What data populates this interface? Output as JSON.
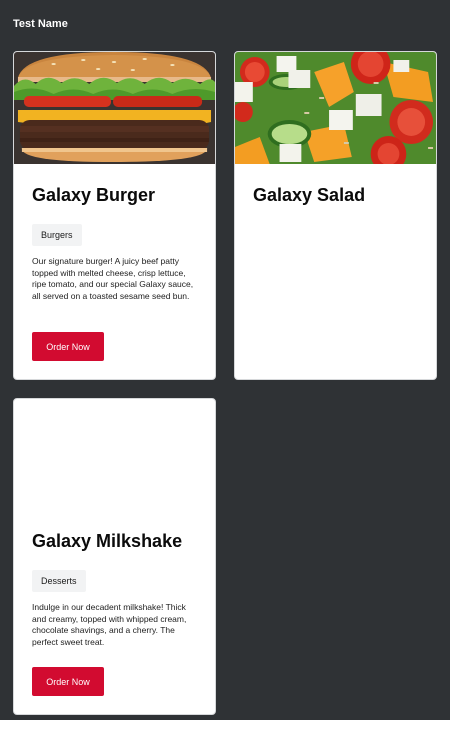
{
  "page": {
    "title": "Test Name"
  },
  "colors": {
    "background": "#2f3235",
    "card": "#ffffff",
    "accent": "#d20b30",
    "badge": "#f2f3f4"
  },
  "cards": [
    {
      "title": "Galaxy Burger",
      "category": "Burgers",
      "description": "Our signature burger! A juicy beef patty topped with melted cheese, crisp lettuce, ripe tomato, and our special Galaxy sauce, all served on a toasted sesame seed bun.",
      "button_label": "Order Now",
      "image": "burger-photo"
    },
    {
      "title": "Galaxy Salad",
      "image": "salad-photo"
    },
    {
      "title": "Galaxy Milkshake",
      "category": "Desserts",
      "description": "Indulge in our decadent milkshake! Thick and creamy, topped with whipped cream, chocolate shavings, and a cherry. The perfect sweet treat.",
      "button_label": "Order Now"
    }
  ]
}
